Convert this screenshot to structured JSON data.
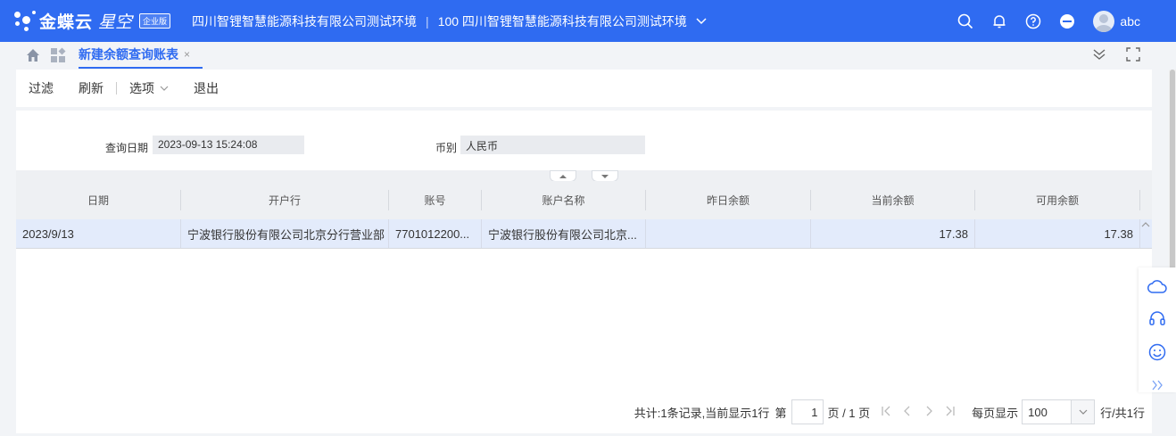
{
  "app": {
    "logo_text": "金蝶云",
    "logo_sub": "星空",
    "edition": "企业版",
    "org_name": "四川智锂智慧能源科技有限公司测试环境",
    "org_code_name": "100 四川智锂智慧能源科技有限公司测试环境",
    "user": "abc",
    "brand_color": "#2f6bf1"
  },
  "tabs": {
    "active_label": "新建余额查询账表",
    "close_glyph": "×"
  },
  "toolbar": {
    "filter": "过滤",
    "refresh": "刷新",
    "options": "选项",
    "exit": "退出"
  },
  "filters": {
    "query_date_label": "查询日期",
    "query_date_value": "2023-09-13 15:24:08",
    "currency_label": "币别",
    "currency_value": "人民币"
  },
  "grid": {
    "columns": [
      "日期",
      "开户行",
      "账号",
      "账户名称",
      "昨日余额",
      "当前余额",
      "可用余额"
    ],
    "rows": [
      [
        "2023/9/13",
        "宁波银行股份有限公司北京分行营业部",
        "7701012200...",
        "宁波银行股份有限公司北京...",
        "",
        "17.38",
        "17.38"
      ]
    ]
  },
  "pager": {
    "summary": "共计:1条记录,当前显示1行",
    "page_prefix": "第",
    "page_value": "1",
    "page_suffix": "页 / 1 页",
    "page_size_label": "每页显示",
    "page_size_value": "100",
    "tail": "行/共1行"
  }
}
